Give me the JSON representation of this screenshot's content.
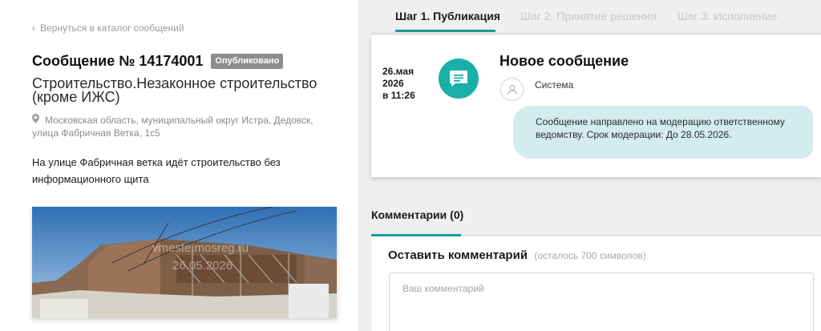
{
  "left": {
    "back_link": "Вернуться в каталог сообщений",
    "message_title": "Сообщение № 14174001",
    "status_badge": "Опубликовано",
    "category": "Строительство.Незаконное строительство (кроме ИЖС)",
    "address": "Московская область, муниципальный округ Истра, Дедовск, улица Фабричная Ветка, 1с5",
    "description": "На улице Фабричная ветка идёт строительство без информационного щита",
    "photo": {
      "watermark_site": "vmeste.mosreg.ru",
      "watermark_date": "26.05.2026"
    }
  },
  "steps": [
    {
      "label": "Шаг 1. Публикация",
      "active": true
    },
    {
      "label": "Шаг 2. Принятие решения",
      "active": false
    },
    {
      "label": "Шаг 3. Исполнение",
      "active": false
    }
  ],
  "event": {
    "date_line1": "26.мая",
    "date_line2": "2026",
    "date_line3": "в 11:26",
    "title": "Новое сообщение",
    "author": "Система",
    "text": "Сообщение направлено на модерацию ответственному ведомству. Срок модерации: До 28.05.2026.",
    "icon": "chat-bubble-icon"
  },
  "comments": {
    "tab_label": "Комментарии (0)",
    "heading": "Оставить комментарий",
    "limit_note": "(осталось 700 символов)",
    "placeholder": "Ваш комментарий"
  },
  "colors": {
    "accent": "#179c97",
    "event_icon_bg": "#1aafa8",
    "bubble_bg": "#d3ecee",
    "badge_bg": "#8d8d8d"
  }
}
